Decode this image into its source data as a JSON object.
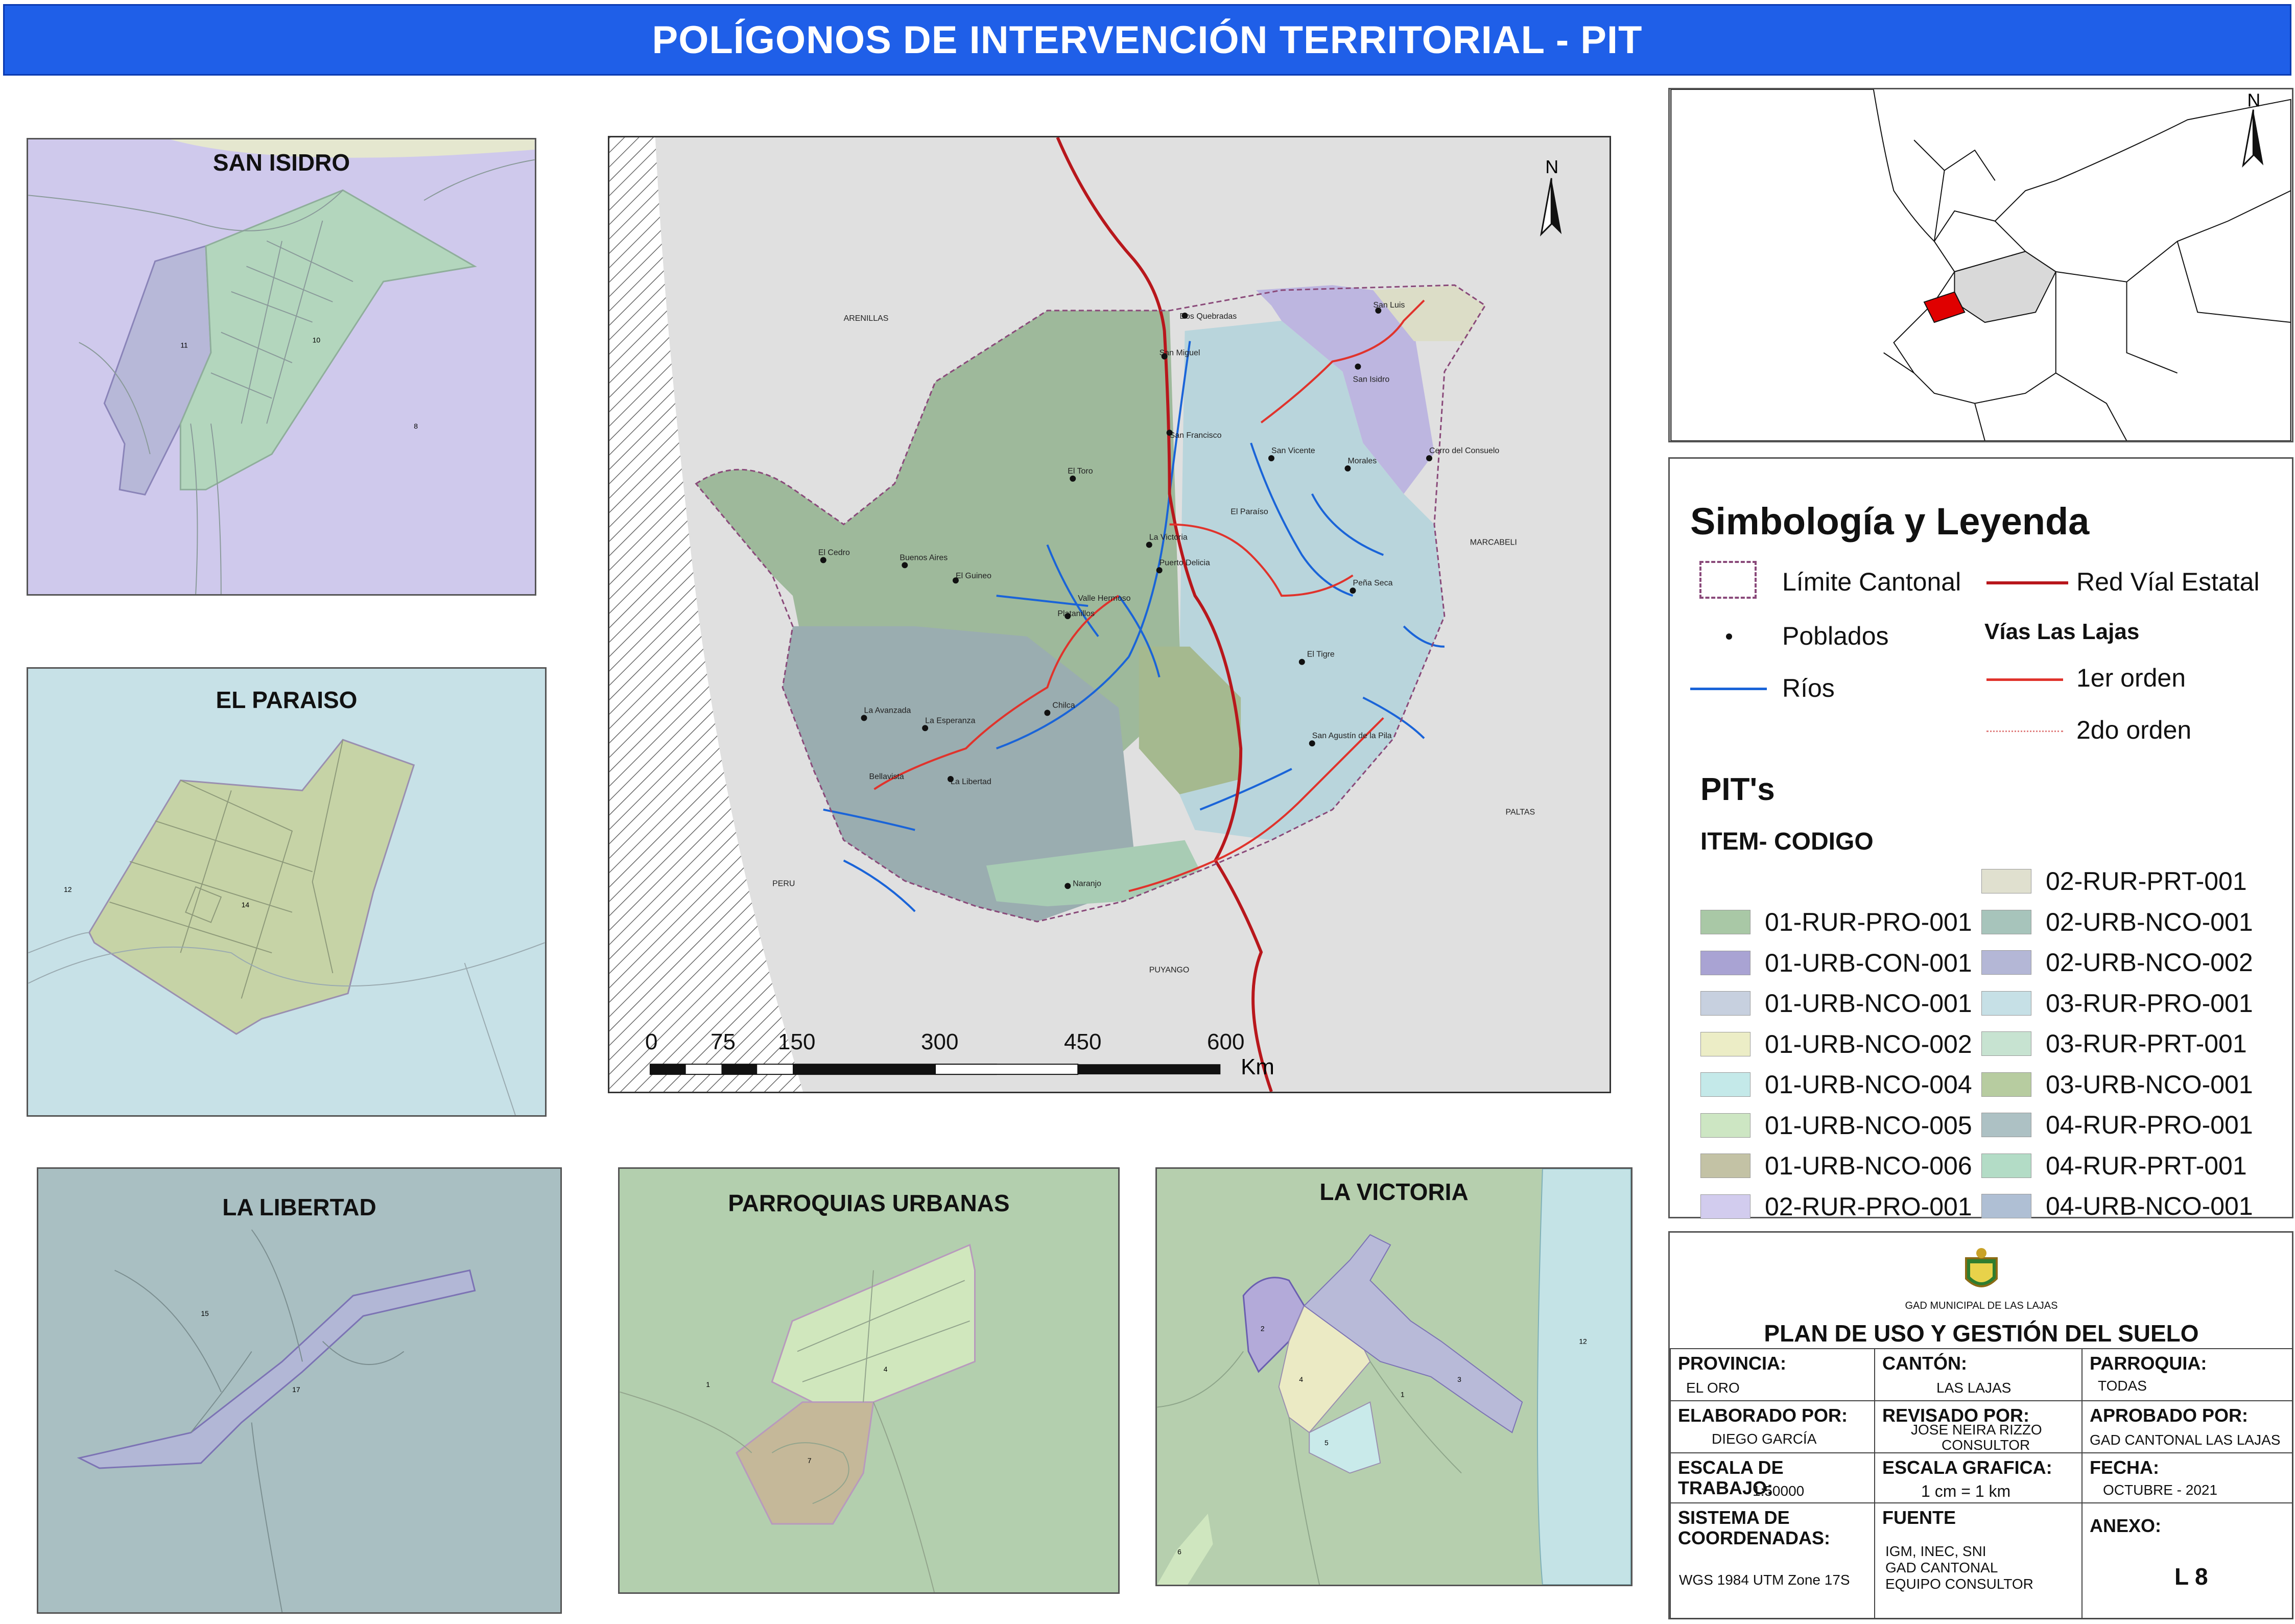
{
  "header": {
    "title": "POLÍGONOS DE INTERVENCIÓN TERRITORIAL - PIT"
  },
  "insets": {
    "san_isidro": {
      "title": "SAN ISIDRO",
      "labels": [
        "11",
        "10",
        "8"
      ]
    },
    "el_paraiso": {
      "title": "EL PARAISO",
      "labels": [
        "12",
        "14"
      ]
    },
    "la_libertad": {
      "title": "LA LIBERTAD",
      "labels": [
        "15",
        "17"
      ]
    },
    "parroquias_urbanas": {
      "title": "PARROQUIAS URBANAS",
      "labels": [
        "1",
        "4",
        "7"
      ]
    },
    "la_victoria": {
      "title": "LA VICTORIA",
      "labels": [
        "2",
        "4",
        "3",
        "1",
        "5",
        "12",
        "6"
      ]
    }
  },
  "main_map": {
    "north": "N",
    "place_labels": [
      "ARENILLAS",
      "MARCABELI",
      "PALTAS",
      "PERU",
      "PUYANGO",
      "Dos Quebradas",
      "San Luis",
      "San Miguel",
      "San Isidro",
      "San Francisco",
      "San Vicente",
      "Morales",
      "Cerro del Consuelo",
      "El Toro",
      "El Paraíso",
      "La Victoria",
      "El Cedro",
      "Buenos Aires",
      "El Guineo",
      "Puerto Delicia",
      "Valle Hermoso",
      "Platanillos",
      "Peña Seca",
      "El Tigre",
      "Chilca",
      "La Avanzada",
      "La Esperanza",
      "Bellavista",
      "La Libertad",
      "San Agustín de la Pila",
      "Naranjo"
    ],
    "scale_bar": {
      "ticks": [
        "0",
        "75",
        "150",
        "300",
        "450",
        "600"
      ],
      "unit": "Km"
    }
  },
  "locator": {
    "north": "N"
  },
  "legend": {
    "title": "Simbología y Leyenda",
    "limite": "Límite Cantonal",
    "red_vial": "Red Víal Estatal",
    "poblados": "Poblados",
    "vias_title": "Vías Las Lajas",
    "rios": "Ríos",
    "primer_orden": "1er orden",
    "segundo_orden": "2do orden",
    "pits_title": "PIT's",
    "item_codigo": "ITEM- CODIGO",
    "pits_left": [
      {
        "label": "01-RUR-PRO-001",
        "color": "#a9c8a6"
      },
      {
        "label": "01-URB-CON-001",
        "color": "#a9a3d3"
      },
      {
        "label": "01-URB-NCO-001",
        "color": "#c7d0df"
      },
      {
        "label": "01-URB-NCO-002",
        "color": "#ecedc6"
      },
      {
        "label": "01-URB-NCO-004",
        "color": "#c4e9e9"
      },
      {
        "label": "01-URB-NCO-005",
        "color": "#cde6c3"
      },
      {
        "label": "01-URB-NCO-006",
        "color": "#c3c2a5"
      },
      {
        "label": "02-RUR-PRO-001",
        "color": "#d2ccee"
      }
    ],
    "pits_right": [
      {
        "label": "02-RUR-PRT-001",
        "color": "#e0e0cf"
      },
      {
        "label": "02-URB-NCO-001",
        "color": "#a7c4bb"
      },
      {
        "label": "02-URB-NCO-002",
        "color": "#b4b7d6"
      },
      {
        "label": "03-RUR-PRO-001",
        "color": "#c6e0e6"
      },
      {
        "label": "03-RUR-PRT-001",
        "color": "#c7e3d1"
      },
      {
        "label": "03-URB-NCO-001",
        "color": "#b7cca0"
      },
      {
        "label": "04-RUR-PRO-001",
        "color": "#adc1c4"
      },
      {
        "label": "04-RUR-PRT-001",
        "color": "#b3dcc6"
      },
      {
        "label": "04-URB-NCO-001",
        "color": "#afbfd4"
      }
    ]
  },
  "title_block": {
    "logo_caption": "GAD MUNICIPAL DE LAS LAJAS",
    "plan_title": "PLAN DE USO Y GESTIÓN DEL SUELO",
    "provincia_h": "PROVINCIA:",
    "provincia_v": "EL ORO",
    "canton_h": "CANTÓN:",
    "canton_v": "LAS LAJAS",
    "parroquia_h": "PARROQUIA:",
    "parroquia_v": "TODAS",
    "elaborado_h": "ELABORADO POR:",
    "elaborado_v": "DIEGO GARCÍA",
    "revisado_h": "REVISADO POR:",
    "revisado_v1": "JOSE NEIRA RIZZO",
    "revisado_v2": "CONSULTOR",
    "aprobado_h": "APROBADO POR:",
    "aprobado_v": "GAD CANTONAL LAS LAJAS",
    "escala_trabajo_h": "ESCALA DE TRABAJO:",
    "escala_trabajo_v": "1:50000",
    "escala_grafica_h": "ESCALA GRAFICA:",
    "escala_grafica_v": "1 cm = 1 km",
    "fecha_h": "FECHA:",
    "fecha_v": "OCTUBRE - 2021",
    "sistema_h1": "SISTEMA DE",
    "sistema_h2": "COORDENADAS:",
    "sistema_v": "WGS 1984 UTM Zone 17S",
    "fuente_h": "FUENTE",
    "fuente_v1": "IGM, INEC, SNI",
    "fuente_v2": "GAD CANTONAL",
    "fuente_v3": "EQUIPO CONSULTOR",
    "anexo_h": "ANEXO:",
    "anexo_v": "L 8"
  },
  "colors": {
    "title_bar": "#1f5fe8",
    "road_state": "#b8171c",
    "road_first": "#e0332c",
    "river": "#1a64d8",
    "canton_limit": "#8a4a7a"
  }
}
